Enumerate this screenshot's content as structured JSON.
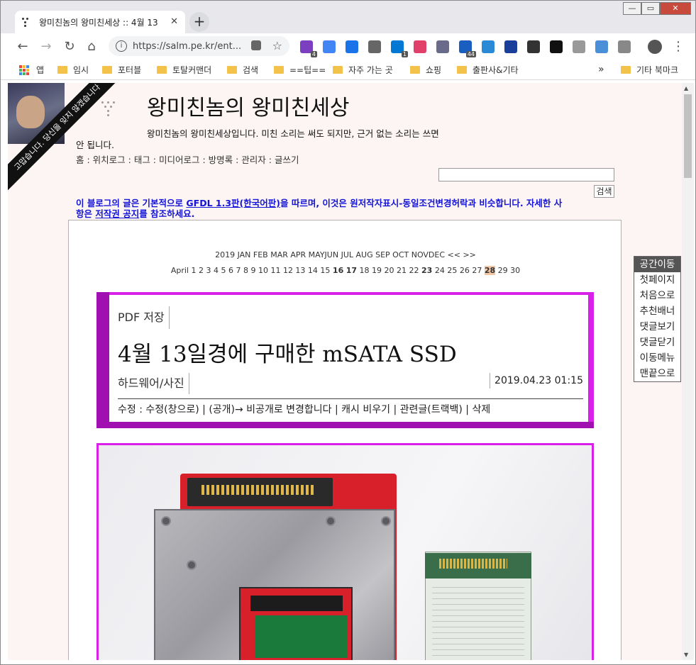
{
  "browser": {
    "tab_title": "왕미친놈의 왕미친세상 :: 4월 13",
    "tab_close": "✕",
    "new_tab": "+",
    "url": "https://salm.pe.kr/ent...",
    "window_controls": {
      "minimize": "—",
      "maximize": "▭",
      "close": "✕"
    },
    "nav": {
      "back": "←",
      "forward": "→",
      "reload": "↻",
      "home": "⌂",
      "star": "☆",
      "menu": "⋮"
    },
    "extensions": [
      {
        "name": "purple-ext-icon",
        "color": "#7b3fbf",
        "badge": "4"
      },
      {
        "name": "translate-icon",
        "color": "#4285f4",
        "badge": ""
      },
      {
        "name": "checkbox-icon",
        "color": "#1a73e8",
        "badge": ""
      },
      {
        "name": "puzzle-icon",
        "color": "#666666",
        "badge": ""
      },
      {
        "name": "skype-icon",
        "color": "#0078d4",
        "badge": "1"
      },
      {
        "name": "chat-icon",
        "color": "#e0406a",
        "badge": ""
      },
      {
        "name": "pen-icon",
        "color": "#6a6a8a",
        "badge": ""
      },
      {
        "name": "counter-icon",
        "color": "#1a5fbf",
        "badge": "44"
      },
      {
        "name": "cloud-icon",
        "color": "#2a8ad8",
        "badge": ""
      },
      {
        "name": "save-icon",
        "color": "#1a3f9a",
        "badge": ""
      },
      {
        "name": "reel-icon",
        "color": "#333333",
        "badge": ""
      },
      {
        "name": "download-icon",
        "color": "#111111",
        "badge": ""
      },
      {
        "name": "profile-ext-icon",
        "color": "#999999",
        "badge": ""
      },
      {
        "name": "settings-ext-icon",
        "color": "#4a90d9",
        "badge": ""
      },
      {
        "name": "globe-icon",
        "color": "#888888",
        "badge": ""
      }
    ]
  },
  "bookmarks": {
    "apps": "앱",
    "items": [
      "임시",
      "포터블",
      "토탈커맨더",
      "검색",
      "==팁==",
      "자주 가는 곳",
      "쇼핑",
      "출판사&기타"
    ],
    "more": "»",
    "other": "기타 북마크"
  },
  "blog": {
    "ribbon_text": "고맙습니다. 당신을 잊지 않겠습니다",
    "title": "왕미친놈의 왕미친세상",
    "description": "왕미친놈의 왕미친세상입니다. 미친 소리는 써도 되지만, 근거 없는 소리는 쓰면 안 됩니다.",
    "nav": "홈 : 위치로그 : 태그 : 미디어로그 : 방명록 : 관리자 : 글쓰기",
    "search_button": "검색",
    "license_1": "이 블로그의 글은 기본적으로 ",
    "license_link1": "GFDL 1.3판(한국어판)",
    "license_2": "을 따르며, 이것은 원저작자표시-동일조건변경허락과 비슷합니다. 자세한 사항은 ",
    "license_link2": "저작권 공지",
    "license_3": "를 참조하세요."
  },
  "calendar": {
    "months": "2019  JAN FEB MAR APR MAYJUN JUL AUG SEP OCT NOVDEC  << >>",
    "month_label": "April",
    "days_a": "1 2 3 4 5 6 7 8 9 10 11 12 13 14 15",
    "bold_1": "16",
    "bold_2": "17",
    "days_b": "18 19 20 21 22",
    "bold_3": "23",
    "days_c": "24 25 26 27",
    "today": "28",
    "days_d": "29 30"
  },
  "post": {
    "pdf_label": "PDF 저장",
    "title": "4월 13일경에 구매한 mSATA SSD",
    "category": "하드웨어/사진",
    "date": "2019.04.23 01:15",
    "actions": "수정 : 수정(창으로) | (공개)→ 비공개로 변경합니다 | 캐시 비우기 | 관련글(트랙백) | 삭제"
  },
  "side_menu": {
    "header": "공간이동",
    "items": [
      "첫페이지",
      "처음으로",
      "추천배너",
      "댓글보기",
      "댓글닫기",
      "이동메뉴",
      "맨끝으로"
    ]
  }
}
